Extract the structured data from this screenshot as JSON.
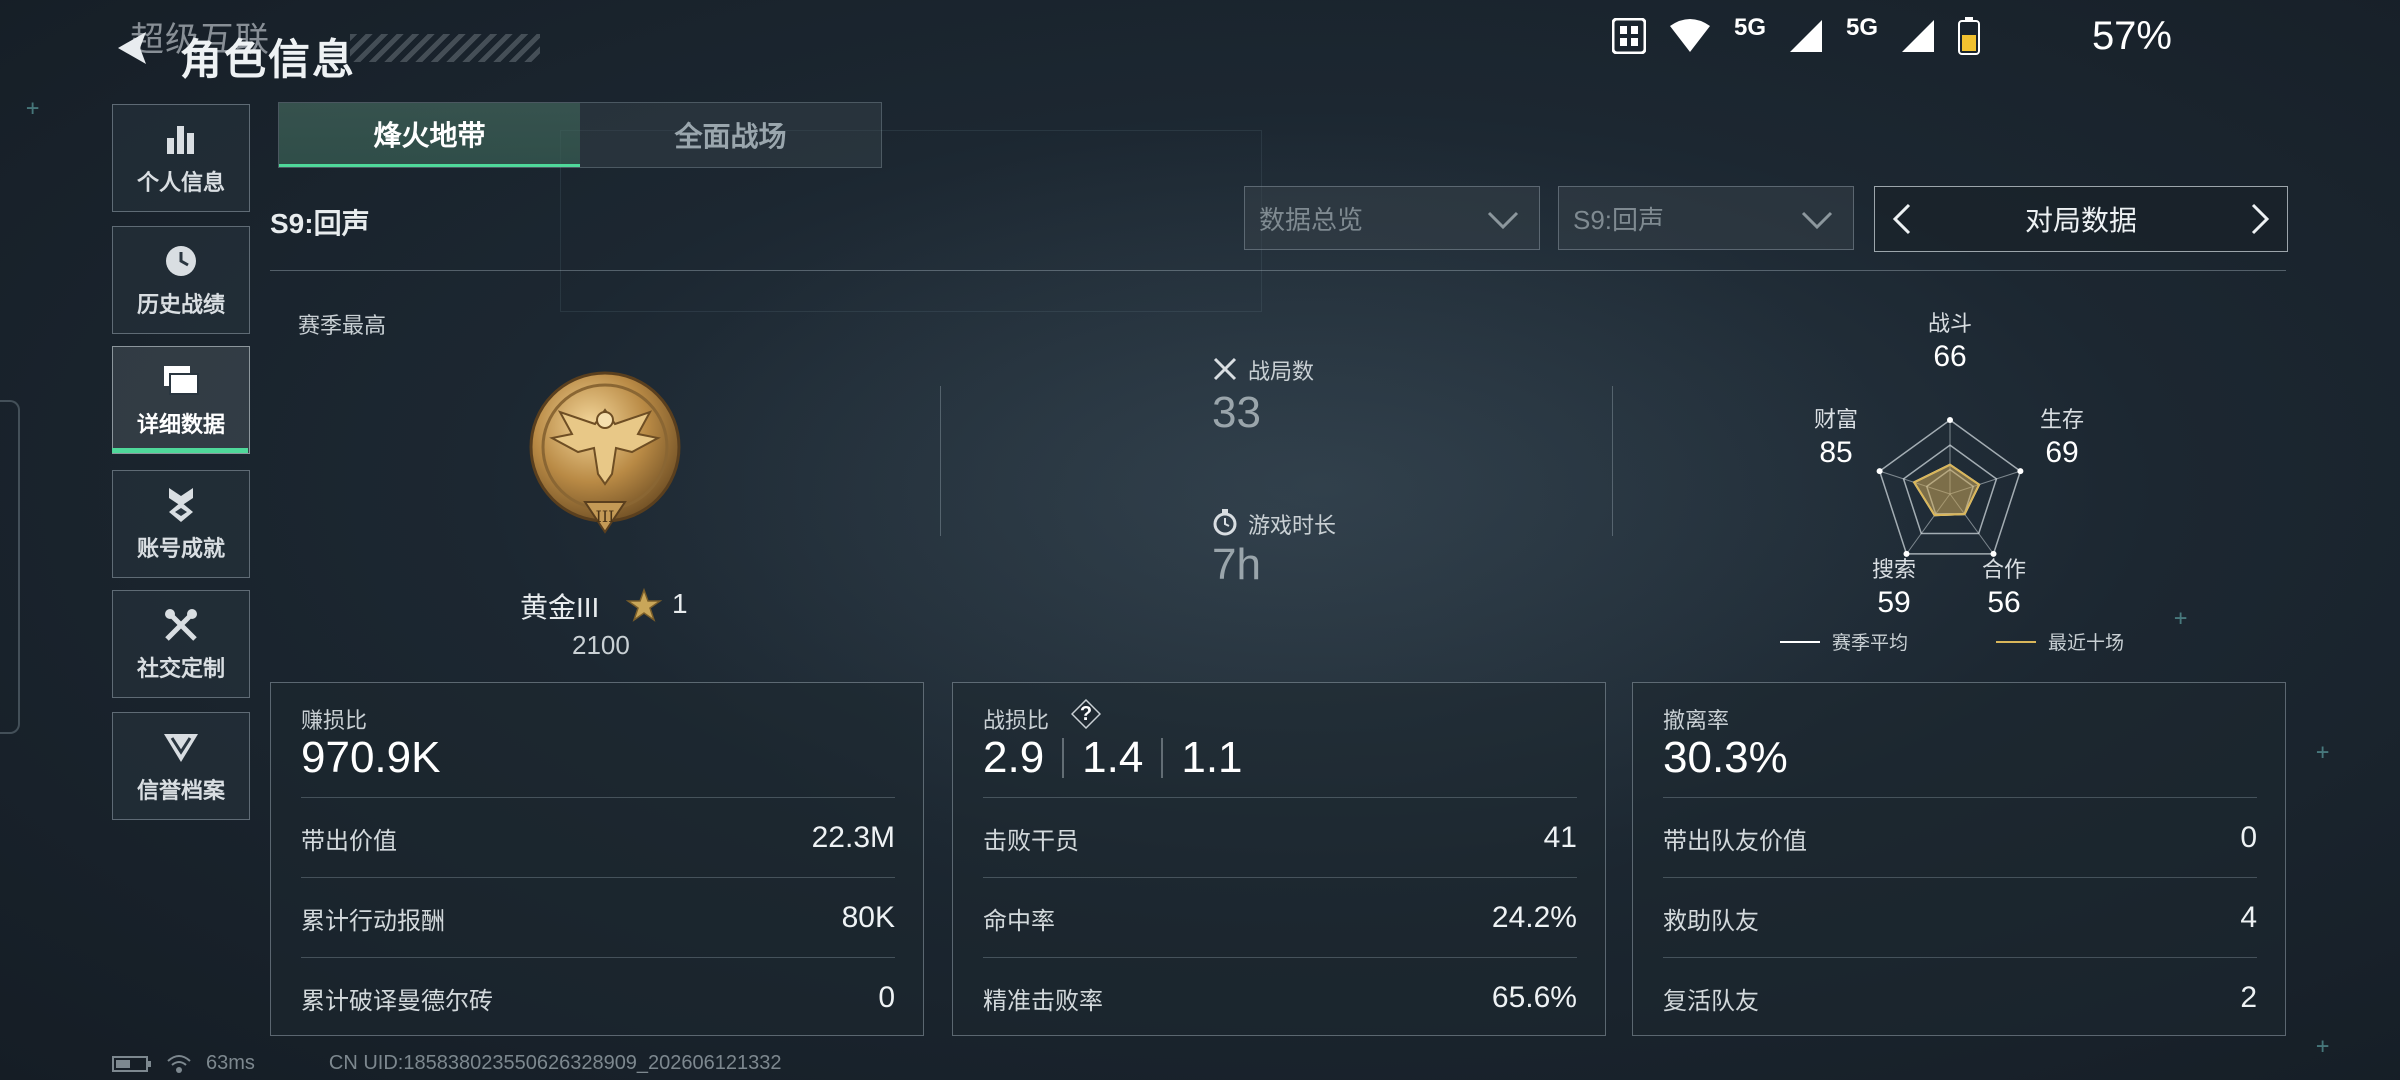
{
  "status_bar": {
    "network_1": "5G",
    "network_2": "5G",
    "battery": "57%"
  },
  "header": {
    "ghost_title": "超级互联",
    "title": "角色信息"
  },
  "sidebar": {
    "items": [
      {
        "label": "个人信息",
        "icon": "bar-chart-icon"
      },
      {
        "label": "历史战绩",
        "icon": "clock-icon"
      },
      {
        "label": "详细数据",
        "icon": "folder-icon",
        "active": true
      },
      {
        "label": "账号成就",
        "icon": "medal-icon"
      },
      {
        "label": "社交定制",
        "icon": "tools-icon"
      },
      {
        "label": "信誉档案",
        "icon": "shield-icon"
      }
    ]
  },
  "tabs": [
    {
      "label": "烽火地带",
      "active": true
    },
    {
      "label": "全面战场",
      "active": false
    }
  ],
  "season_label": "S9:回声",
  "filters": {
    "overview": "数据总览",
    "season": "S9:回声",
    "mode": "对局数据"
  },
  "rank": {
    "section_label": "赛季最高",
    "name": "黄金III",
    "stars": "1",
    "score": "2100",
    "badge_numeral": "III"
  },
  "summary": {
    "matches_label": "战局数",
    "matches_value": "33",
    "time_label": "游戏时长",
    "time_value": "7h"
  },
  "radar": {
    "axes": [
      {
        "label": "战斗",
        "value": 66
      },
      {
        "label": "生存",
        "value": 69
      },
      {
        "label": "合作",
        "value": 56
      },
      {
        "label": "搜索",
        "value": 59
      },
      {
        "label": "财富",
        "value": 85
      }
    ],
    "legend_avg": "赛季平均",
    "legend_recent": "最近十场",
    "color_avg": "#ffffff",
    "color_recent": "#d9b65a"
  },
  "cards": [
    {
      "title": "赚损比",
      "value": "970.9K",
      "rows": [
        {
          "k": "带出价值",
          "v": "22.3M"
        },
        {
          "k": "累计行动报酬",
          "v": "80K"
        },
        {
          "k": "累计破译曼德尔砖",
          "v": "0"
        }
      ]
    },
    {
      "title": "战损比",
      "values": [
        "2.9",
        "1.4",
        "1.1"
      ],
      "help": "?",
      "rows": [
        {
          "k": "击败干员",
          "v": "41"
        },
        {
          "k": "命中率",
          "v": "24.2%"
        },
        {
          "k": "精准击败率",
          "v": "65.6%"
        }
      ]
    },
    {
      "title": "撤离率",
      "value": "30.3%",
      "rows": [
        {
          "k": "带出队友价值",
          "v": "0"
        },
        {
          "k": "救助队友",
          "v": "4"
        },
        {
          "k": "复活队友",
          "v": "2"
        }
      ]
    }
  ],
  "footer": {
    "ping": "63ms",
    "uid": "CN UID:185838023550626328909_202606121332"
  },
  "colors": {
    "accent": "#4fd89a",
    "gold": "#c99a4a"
  }
}
